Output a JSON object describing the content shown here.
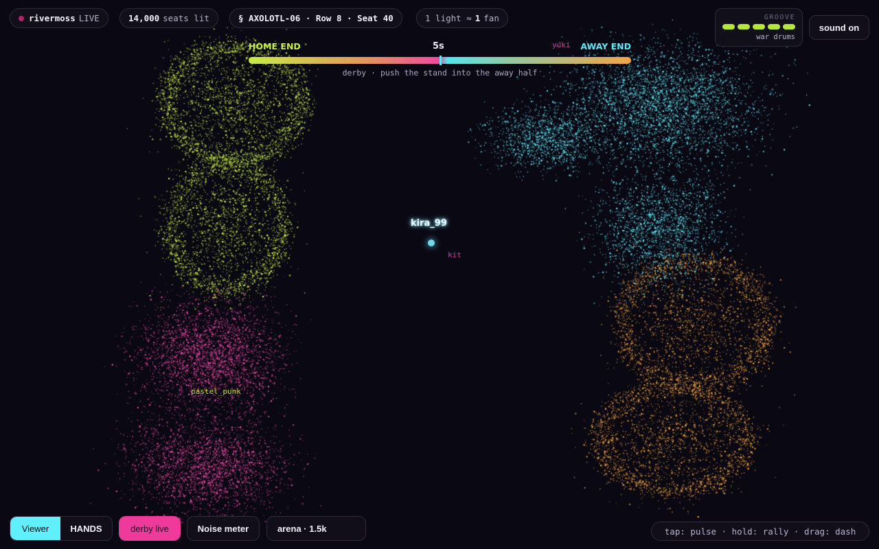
{
  "top_bar": {
    "brand": "rivermoss",
    "live": "LIVE",
    "seats_count": "14,000",
    "seats_text": "seats lit",
    "seat_label": "§ AXOLOTL-06 · Row 8 · Seat 40",
    "ratio_prefix": "1 light ≈",
    "ratio_value": "1",
    "ratio_suffix": "fan"
  },
  "groove": {
    "label": "GROOVE",
    "level": 5,
    "max": 5,
    "mode": "war drums"
  },
  "sound_button": "sound on",
  "derby": {
    "home_label": "HOME END",
    "away_label": "AWAY END",
    "timer": "5s",
    "balance": 0.5,
    "subtitle": "derby · push the stand into the away half"
  },
  "crowd_tags": {
    "player": "kira_99",
    "yuki": "yuki",
    "kit": "kit",
    "pastel": "pastel_punk"
  },
  "bottom_bar": {
    "viewer": "Viewer",
    "hands": "HANDS",
    "derby_live": "derby live",
    "noise_meter": "Noise meter",
    "arena": "arena · 1.5k",
    "hint": "tap: pulse · hold: rally · drag: dash"
  },
  "colors": {
    "home": "#c8f04a",
    "away": "#5fe8f5",
    "pink": "#ee4aa8",
    "orange": "#f5a43c",
    "accent": "#5ff0fb"
  }
}
